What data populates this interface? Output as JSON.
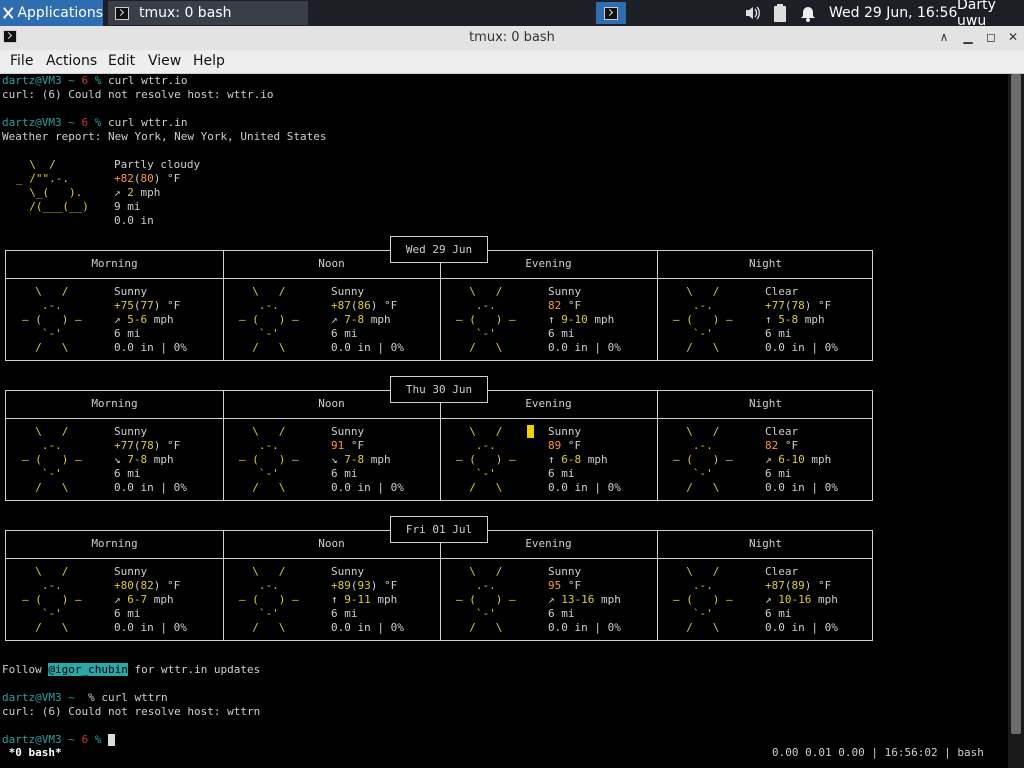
{
  "panel": {
    "apps_label": "Applications",
    "task_label": "tmux: 0 bash",
    "clock": "Wed 29 Jun, 16:56",
    "user": "Darty uwu"
  },
  "window": {
    "title": "tmux: 0 bash"
  },
  "menu": {
    "file": "File",
    "actions": "Actions",
    "edit": "Edit",
    "view": "View",
    "help": "Help"
  },
  "terminal": {
    "prompt_user": "dartz@VM3",
    "prompt_sep": " ~ ",
    "prompt_num": "6",
    "prompt_pct": " %",
    "cmd1": " curl wttr.io",
    "err1": "curl: (6) Could not resolve host: wttr.io",
    "cmd2": " curl wttr.in",
    "report": "Weather report: New York, New York, United States",
    "current": {
      "art": [
        "  \\  /      ",
        "_ /\"\".-.    ",
        "  \\_(   ).  ",
        "  /(___(__) "
      ],
      "cond": "Partly cloudy",
      "temp": "+82",
      "temp_feel": "80",
      "unit": "°F",
      "wind_arrow": "↗",
      "wind": "2",
      "wind_unit": "mph",
      "vis": "9 mi",
      "precip": "0.0 in"
    },
    "sun_art": [
      "  \\   /    ",
      "   .-.     ",
      "― (   ) ―  ",
      "   `-'     ",
      "  /   \\    "
    ],
    "clear_art": [
      "  \\   /    ",
      "   .-.     ",
      "― (   ) ―  ",
      "   `-'     ",
      "  /   \\    "
    ],
    "periods": [
      "Morning",
      "Noon",
      "Evening",
      "Night"
    ],
    "days": [
      {
        "date": "Wed 29 Jun",
        "cells": [
          {
            "cond": "Sunny",
            "temp": "+75",
            "feel": "77",
            "wind_arrow": "↗",
            "wind": "5-6",
            "vis": "6 mi",
            "precip": "0.0 in | 0%"
          },
          {
            "cond": "Sunny",
            "temp": "+87",
            "feel": "86",
            "wind_arrow": "↗",
            "wind": "7-8",
            "vis": "6 mi",
            "precip": "0.0 in | 0%"
          },
          {
            "cond": "Sunny",
            "temp": "82",
            "feel": "",
            "wind_arrow": "↑",
            "wind": "9-10",
            "vis": "6 mi",
            "precip": "0.0 in | 0%"
          },
          {
            "cond": "Clear",
            "temp": "+77",
            "feel": "78",
            "wind_arrow": "↑",
            "wind": "5-8",
            "vis": "6 mi",
            "precip": "0.0 in | 0%"
          }
        ]
      },
      {
        "date": "Thu 30 Jun",
        "cells": [
          {
            "cond": "Sunny",
            "temp": "+77",
            "feel": "78",
            "wind_arrow": "↘",
            "wind": "7-8",
            "vis": "6 mi",
            "precip": "0.0 in | 0%"
          },
          {
            "cond": "Sunny",
            "temp": "91",
            "feel": "",
            "wind_arrow": "↘",
            "wind": "7-8",
            "vis": "6 mi",
            "precip": "0.0 in | 0%"
          },
          {
            "cond": "Sunny",
            "temp": "89",
            "feel": "",
            "wind_arrow": "↑",
            "wind": "6-8",
            "vis": "6 mi",
            "precip": "0.0 in | 0%"
          },
          {
            "cond": "Clear",
            "temp": "82",
            "feel": "",
            "wind_arrow": "↗",
            "wind": "6-10",
            "vis": "6 mi",
            "precip": "0.0 in | 0%"
          }
        ]
      },
      {
        "date": "Fri 01 Jul",
        "cells": [
          {
            "cond": "Sunny",
            "temp": "+80",
            "feel": "82",
            "wind_arrow": "↗",
            "wind": "6-7",
            "vis": "6 mi",
            "precip": "0.0 in | 0%"
          },
          {
            "cond": "Sunny",
            "temp": "+89",
            "feel": "93",
            "wind_arrow": "↑",
            "wind": "9-11",
            "vis": "6 mi",
            "precip": "0.0 in | 0%"
          },
          {
            "cond": "Sunny",
            "temp": "95",
            "feel": "",
            "wind_arrow": "↗",
            "wind": "13-16",
            "vis": "6 mi",
            "precip": "0.0 in | 0%"
          },
          {
            "cond": "Clear",
            "temp": "+87",
            "feel": "89",
            "wind_arrow": "↗",
            "wind": "10-16",
            "vis": "6 mi",
            "precip": "0.0 in | 0%"
          }
        ]
      }
    ],
    "follow_pre": "Follow ",
    "follow_handle": "@igor_chubin",
    "follow_post": " for wttr.in updates",
    "prompt2_pct": " %",
    "cmd3": " curl wttrn",
    "err3": "curl: (6) Could not resolve host: wttrn",
    "prompt3_pct": " % "
  },
  "tmux": {
    "window": " *0 bash*",
    "right": "0.00 0.01 0.00 | 16:56:02 | bash"
  },
  "colors": {
    "panel_bg": "#1c2026",
    "accent": "#2f6db1",
    "prompt": "#2aa0a0",
    "sun": "#ddcc33",
    "temp_hot": "#ff9933"
  }
}
